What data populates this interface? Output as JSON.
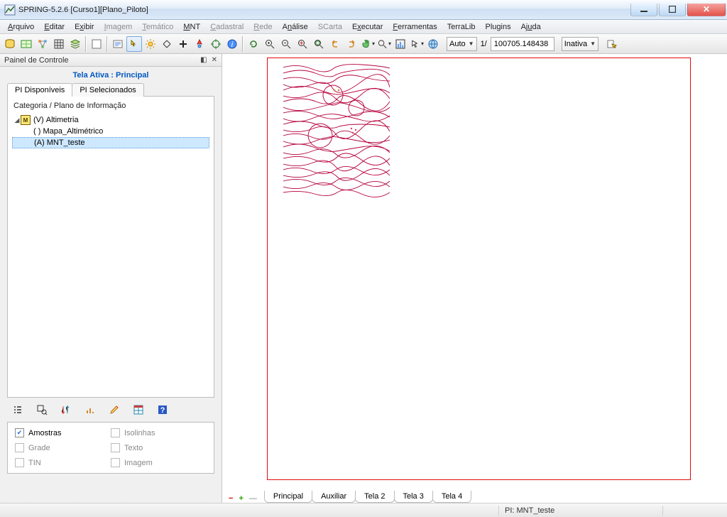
{
  "titlebar": {
    "text": "SPRING-5.2.6 [Curso1][Plano_Piloto]"
  },
  "menu": {
    "arquivo": "Arquivo",
    "editar": "Editar",
    "exibir": "Exibir",
    "imagem": "Imagem",
    "tematico": "Temático",
    "mnt": "MNT",
    "cadastral": "Cadastral",
    "rede": "Rede",
    "analise": "Análise",
    "scarta": "SCarta",
    "executar": "Executar",
    "ferramentas": "Ferramentas",
    "terralib": "TerraLib",
    "plugins": "Plugins",
    "ajuda": "Ajuda"
  },
  "toolbar": {
    "auto": "Auto",
    "scale_prefix": "1/",
    "scale_value": "100705.148438",
    "inativa": "Inativa"
  },
  "panel": {
    "title": "Painel de Controle",
    "tela_ativa": "Tela Ativa : Principal",
    "tab_disponiveis": "PI Disponíveis",
    "tab_selecionados": "PI Selecionados",
    "tree_header": "Categoria / Plano de Informação",
    "tree": {
      "root_prefix": "(V)",
      "root_name": "Altimetria",
      "child1": "( ) Mapa_Altimétrico",
      "child2": "(A) MNT_teste"
    },
    "opts": {
      "amostras": "Amostras",
      "isolinhas": "Isolinhas",
      "grade": "Grade",
      "texto": "Texto",
      "tin": "TIN",
      "imagem": "Imagem"
    }
  },
  "canvas_tabs": {
    "principal": "Principal",
    "auxiliar": "Auxiliar",
    "tela2": "Tela 2",
    "tela3": "Tela 3",
    "tela4": "Tela 4"
  },
  "status": {
    "pi": "PI: MNT_teste"
  }
}
